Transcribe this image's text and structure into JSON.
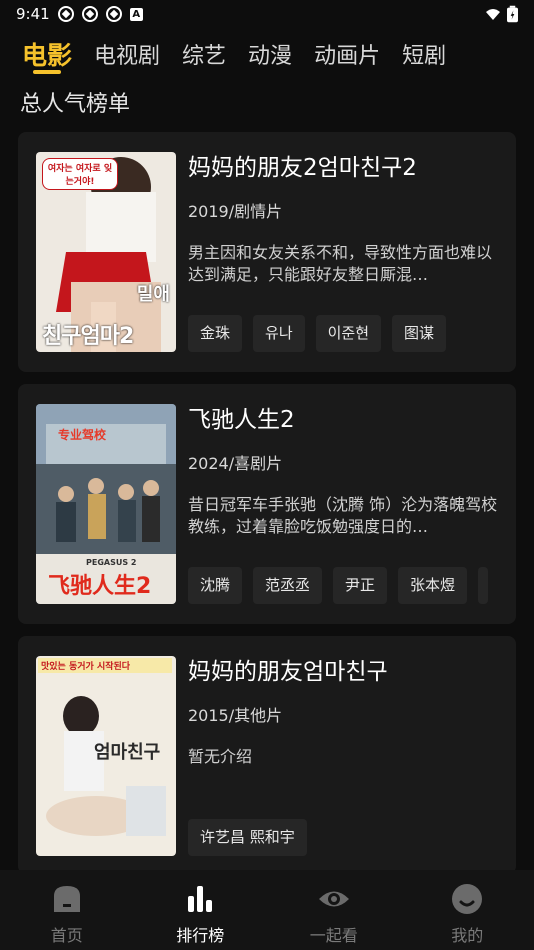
{
  "status_bar": {
    "time": "9:41"
  },
  "tabs": [
    {
      "label": "电影",
      "active": true
    },
    {
      "label": "电视剧",
      "active": false
    },
    {
      "label": "综艺",
      "active": false
    },
    {
      "label": "动漫",
      "active": false
    },
    {
      "label": "动画片",
      "active": false
    },
    {
      "label": "短剧",
      "active": false
    }
  ],
  "section_title": "总人气榜单",
  "movies": [
    {
      "title": "妈妈的朋友2엄마친구2",
      "meta": "2019/剧情片",
      "description": "男主因和女友关系不和，导致性方面也难以达到满足，只能跟好友整日厮混…",
      "cast": [
        "金珠",
        "유나",
        "이준현",
        "图谋"
      ],
      "poster_texts": [
        "여자는 여자로 잊는거야!",
        "밀애",
        "친구엄마2"
      ],
      "poster_colors": [
        "#f2efe8",
        "#c4161c"
      ]
    },
    {
      "title": "飞驰人生2",
      "meta": "2024/喜剧片",
      "description": "昔日冠军车手张驰（沈腾 饰）沦为落魄驾校教练，过着靠脸吃饭勉强度日的…",
      "cast": [
        "沈腾",
        "范丞丞",
        "尹正",
        "张本煜"
      ],
      "poster_texts": [
        "专业驾校",
        "PEGASUS 2",
        "飞驰人生2"
      ],
      "poster_colors": [
        "#5a6f86",
        "#c9a35a"
      ]
    },
    {
      "title": "妈妈的朋友엄마친구",
      "meta": "2015/其他片",
      "description": "暂无介绍",
      "cast": [
        "许艺昌 熙和宇"
      ],
      "poster_texts": [
        "맛있는 동거가 시작된다",
        "엄마친구"
      ],
      "poster_colors": [
        "#f4efe6",
        "#c4161c"
      ]
    }
  ],
  "bottom_nav": [
    {
      "label": "首页",
      "icon": "home-icon",
      "active": false
    },
    {
      "label": "排行榜",
      "icon": "ranking-icon",
      "active": true
    },
    {
      "label": "一起看",
      "icon": "eye-icon",
      "active": false
    },
    {
      "label": "我的",
      "icon": "profile-icon",
      "active": false
    }
  ],
  "colors": {
    "accent": "#f6c22c",
    "background": "#0d0d0d",
    "card": "#1a1a1a"
  }
}
